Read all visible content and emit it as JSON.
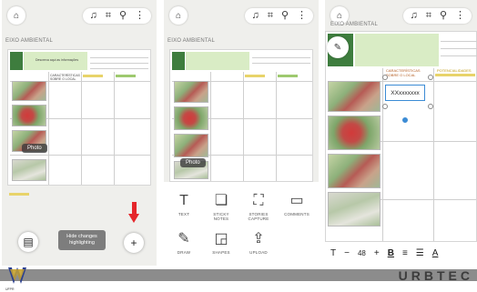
{
  "panel1": {
    "board_title": "EIXO AMBIENTAL",
    "col_header_1": "CARACTERÍSTICAS\nSOBRE O LOCAL",
    "header_text": "Descreva aqui as informações",
    "photo_tooltip": "Photo",
    "hide_btn_line1": "Hide changes",
    "hide_btn_line2": "highlighting",
    "add_glyph": "+",
    "notes_glyph": "▤"
  },
  "panel2": {
    "board_title": "EIXO AMBIENTAL",
    "photo_tooltip": "Photo",
    "tools": [
      {
        "icon": "text-icon",
        "glyph": "T",
        "label": "TEXT"
      },
      {
        "icon": "sticky-note-icon",
        "glyph": "❏",
        "label": "STICKY\nNOTES"
      },
      {
        "icon": "capture-icon",
        "glyph": "⛶",
        "label": "STORIES\nCAPTURE"
      },
      {
        "icon": "comment-icon",
        "glyph": "▭",
        "label": "COMMENTS"
      },
      {
        "icon": "pen-icon",
        "glyph": "✎",
        "label": "DRAW"
      },
      {
        "icon": "shapes-icon",
        "glyph": "◲",
        "label": "SHAPES"
      },
      {
        "icon": "upload-icon",
        "glyph": "⇪",
        "label": "UPLOAD"
      }
    ]
  },
  "panel3": {
    "board_title": "EIXO AMBIENTAL",
    "col_header_1": "CARACTERÍSTICAS\nSOBRE O LOCAL",
    "col_header_2": "POTENCIALIDADES",
    "textbox_value": "XXxxxxxxx",
    "font_size": "48",
    "toolbar": {
      "text": "T",
      "minus": "−",
      "plus": "+",
      "bold": "B",
      "align": "≡",
      "list": "☰",
      "color": "A"
    }
  },
  "topbar": {
    "home": "⌂",
    "bell": "♫",
    "crop": "⌗",
    "search": "⚲",
    "more": "⋮"
  },
  "footer": {
    "brand": "URBTEC",
    "logo_caption": "UFPR"
  },
  "colors": {
    "accent_green": "#3e7d3e",
    "light_green": "#d9ecc5",
    "footer_gray": "#8c8c8c",
    "arrow_red": "#e5262b",
    "select_blue": "#3c8cd5"
  }
}
